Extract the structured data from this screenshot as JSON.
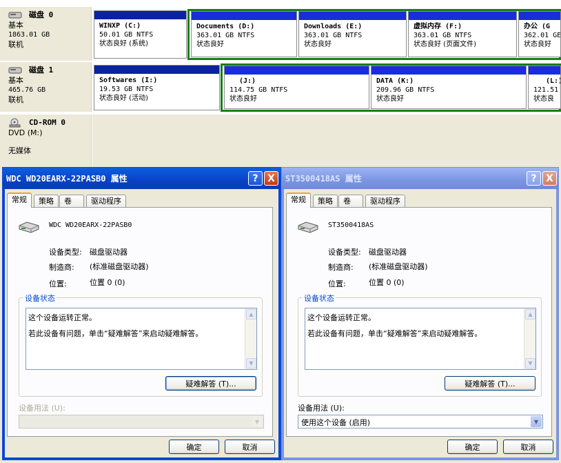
{
  "disks": [
    {
      "name": "磁盘 0",
      "type": "基本",
      "size": "1863.01 GB",
      "status": "联机",
      "partitions": [
        {
          "title": "WINXP  (C:)",
          "meta": "50.01 GB NTFS",
          "status": "状态良好 (系统)"
        },
        {
          "title": "Documents  (D:)",
          "meta": "363.01 GB NTFS",
          "status": "状态良好"
        },
        {
          "title": "Downloads  (E:)",
          "meta": "363.01 GB NTFS",
          "status": "状态良好"
        },
        {
          "title": "虚拟内存  (F:)",
          "meta": "363.01 GB NTFS",
          "status": "状态良好 (页面文件)"
        },
        {
          "title": "办公  (G",
          "meta": "362.01 GE",
          "status": "状态良好"
        }
      ]
    },
    {
      "name": "磁盘 1",
      "type": "基本",
      "size": "465.76 GB",
      "status": "联机",
      "partitions": [
        {
          "title": "Softwares  (I:)",
          "meta": "19.53 GB NTFS",
          "status": "状态良好 (活动)"
        },
        {
          "title": "(J:)",
          "meta": "114.75 GB NTFS",
          "status": "状态良好"
        },
        {
          "title": "DATA  (K:)",
          "meta": "209.96 GB NTFS",
          "status": "状态良好"
        },
        {
          "title": "(L:)",
          "meta": "121.51",
          "status": "状态良"
        }
      ]
    },
    {
      "name": "CD-ROM 0",
      "type": "DVD (M:)",
      "status": "无媒体"
    }
  ],
  "dialogs": [
    {
      "title": "WDC WD20EARX-22PASB0 属性",
      "help": "?",
      "close": "X",
      "tabs": [
        "常规",
        "策略",
        "卷",
        "驱动程序"
      ],
      "device_name": "WDC WD20EARX-22PASB0",
      "type_label": "设备类型:",
      "type_value": "磁盘驱动器",
      "maker_label": "制造商:",
      "maker_value": "(标准磁盘驱动器)",
      "location_label": "位置:",
      "location_value": "位置 0 (0)",
      "group_label": "设备状态",
      "status_line1": "这个设备运转正常。",
      "status_line2": "若此设备有问题，单击“疑难解答”来启动疑难解答。",
      "troubleshoot": "疑难解答 (T)...",
      "usage_label": "设备用法 (U):",
      "usage_value": "",
      "ok": "确定",
      "cancel": "取消"
    },
    {
      "title": "ST3500418AS 属性",
      "help": "?",
      "close": "X",
      "tabs": [
        "常规",
        "策略",
        "卷",
        "驱动程序"
      ],
      "device_name": "ST3500418AS",
      "type_label": "设备类型:",
      "type_value": "磁盘驱动器",
      "maker_label": "制造商:",
      "maker_value": "(标准磁盘驱动器)",
      "location_label": "位置:",
      "location_value": "位置 0 (0)",
      "group_label": "设备状态",
      "status_line1": "这个设备运转正常。",
      "status_line2": "若此设备有问题，单击“疑难解答”来启动疑难解答。",
      "troubleshoot": "疑难解答 (T)...",
      "usage_label": "设备用法 (U):",
      "usage_value": "使用这个设备 (启用)",
      "ok": "确定",
      "cancel": "取消"
    }
  ]
}
